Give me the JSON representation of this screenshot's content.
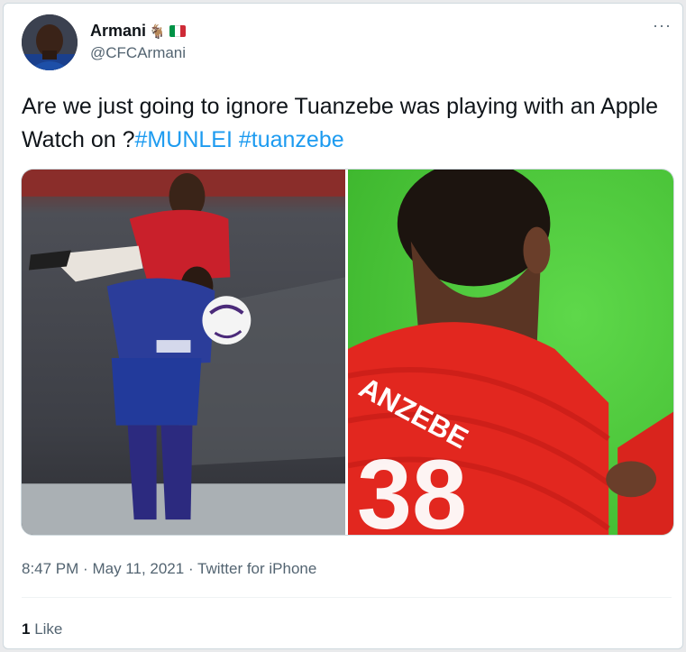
{
  "author": {
    "display_name": "Armani",
    "goat_emoji": "🐐",
    "flag_colors": [
      "#009246",
      "#ffffff",
      "#ce2b37"
    ],
    "handle": "@CFCArmani"
  },
  "more_icon": "···",
  "tweet": {
    "text_plain": "Are we just going to ignore Tuanzebe was playing with an Apple Watch on ?",
    "hashtags": [
      "#MUNLEI",
      "#tuanzebe"
    ]
  },
  "media": {
    "left_photo_text": "Man Utd vs Leicester aerial challenge",
    "right_shirt_text": "ANZEBE",
    "right_number_text": "38"
  },
  "meta": {
    "time": "8:47 PM",
    "separator": "·",
    "date": "May 11, 2021",
    "source": "Twitter for iPhone"
  },
  "engagement": {
    "likes_count": "1",
    "likes_label": "Like"
  },
  "colors": {
    "link": "#1d9bf0",
    "secondary_text": "#536471",
    "primary_text": "#0f1419"
  }
}
